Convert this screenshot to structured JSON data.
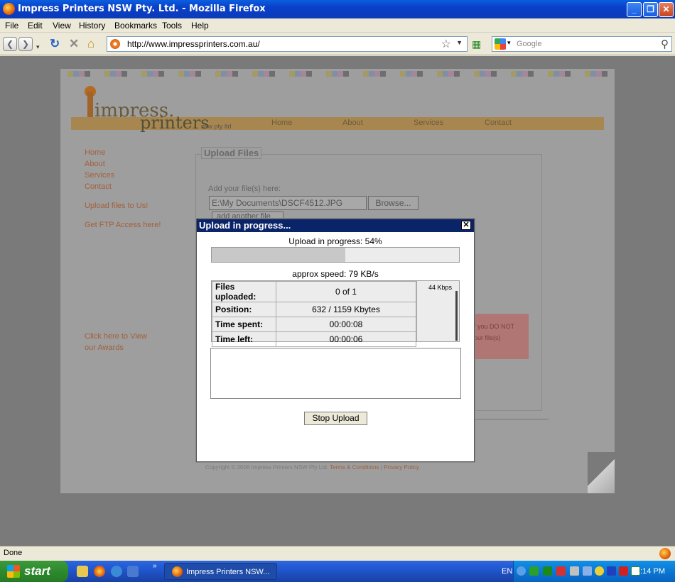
{
  "window": {
    "title": "Impress Printers NSW Pty. Ltd. - Mozilla Firefox"
  },
  "menu": [
    "File",
    "Edit",
    "View",
    "History",
    "Bookmarks",
    "Tools",
    "Help"
  ],
  "toolbar": {
    "url": "http://www.impressprinters.com.au/",
    "search_placeholder": "Google"
  },
  "site": {
    "logo_top": "impress.",
    "logo_bottom": "printers",
    "logo_sub": "nsw pty ltd",
    "topnav": [
      "Home",
      "About",
      "Services",
      "Contact"
    ],
    "sidenav": [
      "Home",
      "About",
      "Services",
      "Contact"
    ],
    "upload_link": "Upload files to Us!",
    "ftp_link": "Get FTP Access here!",
    "awards_line1": "Click here to View",
    "awards_line2": "our Awards",
    "upload_legend": "Upload Files",
    "add_label": "Add your file(s) here:",
    "file_value": "E:\\My Documents\\DSCF4512.JPG",
    "browse_label": "Browse...",
    "add_another_label": "add another file",
    "notice_line1": "f you DO NOT",
    "notice_line2": "our file(s)",
    "copyright": "Copyright © 2006 Impress Printers NSW Pty Ltd.",
    "terms": "Terms & Conditions",
    "separator": "|",
    "privacy": "Privacy Policy"
  },
  "dialog": {
    "title": "Upload in progress...",
    "close": "✕",
    "progress_text": "Upload in progress: 54%",
    "progress": 0.54,
    "speed_text": "approx speed: 79 KB/s",
    "rows": [
      {
        "label": "Files uploaded:",
        "value": "0 of 1"
      },
      {
        "label": "Position:",
        "value": "632 / 1159 Kbytes"
      },
      {
        "label": "Time spent:",
        "value": "00:00:08"
      },
      {
        "label": "Time left:",
        "value": "00:00:06"
      }
    ],
    "graph_label": "44 Kbps",
    "stop_label": "Stop Upload"
  },
  "status": {
    "text": "Done"
  },
  "taskbar": {
    "start": "start",
    "task_title": "Impress Printers NSW...",
    "lang": "EN",
    "clock": "11:14 PM"
  },
  "colors": {
    "accent": "#0a246a",
    "taskbar": "#245edb",
    "start_green": "#2d8a2d",
    "page_bg": "#9e9e9e",
    "link": "#a2603a"
  }
}
